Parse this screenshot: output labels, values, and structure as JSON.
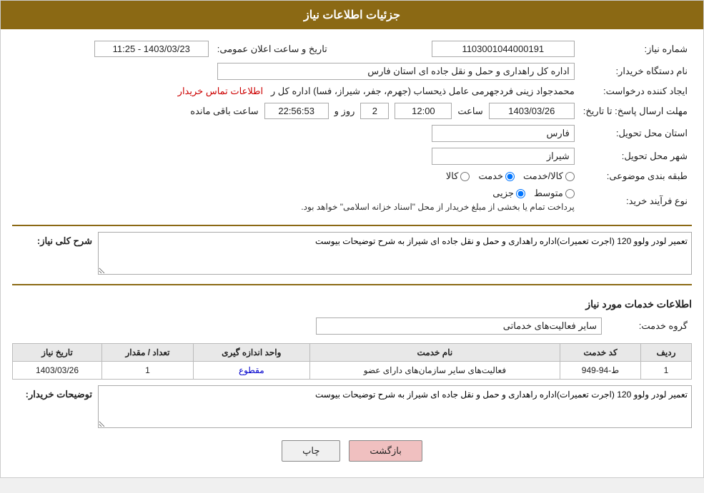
{
  "header": {
    "title": "جزئیات اطلاعات نیاز"
  },
  "labels": {
    "need_number": "شماره نیاز:",
    "buyer_org": "نام دستگاه خریدار:",
    "requester": "ایجاد کننده درخواست:",
    "deadline": "مهلت ارسال پاسخ: تا تاریخ:",
    "province": "استان محل تحویل:",
    "city": "شهر محل تحویل:",
    "category": "طبقه بندی موضوعی:",
    "purchase_type": "نوع فرآیند خرید:",
    "need_desc": "شرح کلی نیاز:",
    "service_info": "اطلاعات خدمات مورد نیاز",
    "service_group": "گروه خدمت:",
    "buyer_desc": "توضیحات خریدار:",
    "date_time": "تاریخ و ساعت اعلان عمومی:",
    "row": "ردیف",
    "service_code": "کد خدمت",
    "service_name": "نام خدمت",
    "unit": "واحد اندازه گیری",
    "quantity": "تعداد / مقدار",
    "need_date": "تاریخ نیاز"
  },
  "values": {
    "need_number": "1103001044000191",
    "buyer_org": "اداره کل راهداری و حمل و نقل جاده ای استان فارس",
    "requester_name": "محمدجواد زینی فردجهرمی عامل ذیحساب (جهرم، جفر، شیراز، فسا) اداره کل ر",
    "requester_link": "اطلاعات تماس خریدار",
    "deadline_date": "1403/03/26",
    "deadline_time": "12:00",
    "deadline_days": "2",
    "deadline_remaining": "22:56:53",
    "province": "فارس",
    "city": "شیراز",
    "category_goods": "کالا",
    "category_service": "خدمت",
    "category_goods_service": "کالا/خدمت",
    "purchase_part": "جزیی",
    "purchase_medium": "متوسط",
    "purchase_notice": "پرداخت تمام یا بخشی از مبلغ خریدار از محل \"اسناد خزانه اسلامی\" خواهد بود.",
    "need_desc_text": "تعمیر لودر ولوو 120 (اجرت تعمیرات)اداره راهداری و حمل و نقل جاده ای شیراز به شرح توضیحات بیوست",
    "service_group_value": "سایر فعالیت‌های خدماتی",
    "public_date": "1403/03/23 - 11:25",
    "table_rows": [
      {
        "row": "1",
        "service_code": "ط-94-949",
        "service_name": "فعالیت‌های سایر سازمان‌های دارای عضو",
        "unit": "مقطوع",
        "quantity": "1",
        "need_date": "1403/03/26"
      }
    ],
    "buyer_desc_text": "تعمیر لودر ولوو 120 (اجرت تعمیرات)اداره راهداری و حمل و نقل جاده ای شیراز به شرح توضیحات بیوست",
    "btn_print": "چاپ",
    "btn_back": "بازگشت",
    "days_label": "روز و",
    "hours_label": "ساعت باقی مانده",
    "time_label": "ساعت"
  },
  "colors": {
    "header_bg": "#8B6914",
    "link_blue": "#0000cc",
    "link_red": "#cc0000",
    "table_header_bg": "#e8e8e8",
    "btn_back_bg": "#f0c0c0"
  }
}
